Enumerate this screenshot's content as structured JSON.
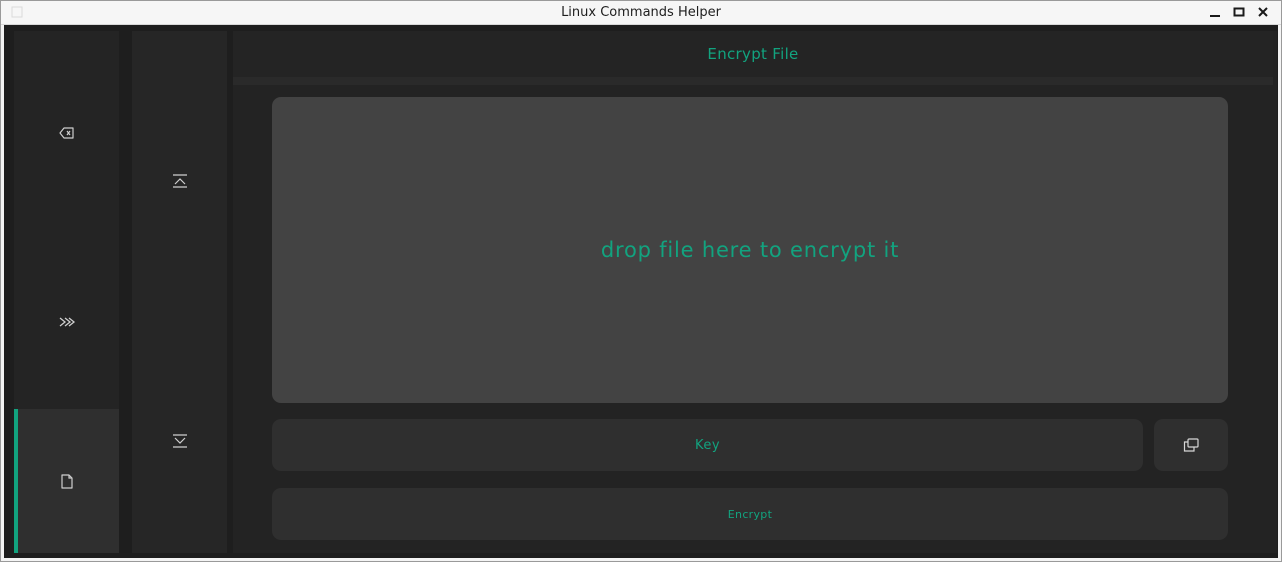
{
  "window": {
    "title": "Linux Commands Helper",
    "controls": [
      "minimize-icon",
      "maximize-icon",
      "close-icon"
    ]
  },
  "primary_nav": {
    "items": [
      {
        "icon": "backspace-icon",
        "active": false
      },
      {
        "icon": "double-chevron-right-icon",
        "active": false
      },
      {
        "icon": "file-icon",
        "active": true
      }
    ]
  },
  "secondary_nav": {
    "items": [
      {
        "icon": "collapse-to-top-icon"
      },
      {
        "icon": "collapse-to-bottom-icon"
      }
    ]
  },
  "main": {
    "title": "Encrypt File",
    "dropzone_text": "drop file here to encrypt it",
    "key_placeholder": "Key",
    "copy_icon": "copy-icon",
    "encrypt_label": "Encrypt"
  },
  "colors": {
    "accent": "#12a37f",
    "background": "#1e1e1e",
    "panel": "#2f2f2f",
    "dropzone": "#434343"
  }
}
